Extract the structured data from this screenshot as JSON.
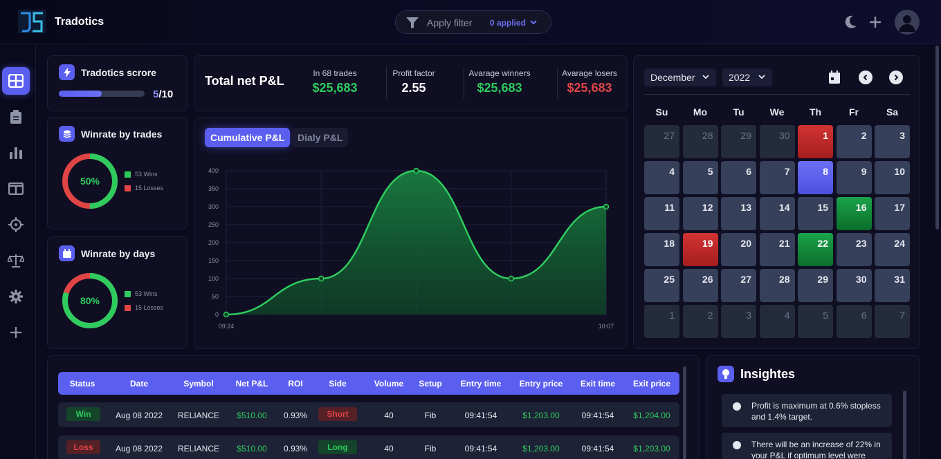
{
  "app": {
    "title": "Tradotics"
  },
  "filter": {
    "label": "Apply filter",
    "applied": "0 applied"
  },
  "sidebar": {
    "items": [
      "dashboard",
      "journal",
      "reports",
      "layout",
      "target",
      "compare",
      "settings",
      "add"
    ]
  },
  "score": {
    "title": "Tradotics scrore",
    "value": "5",
    "max": "/10",
    "fraction": 0.5
  },
  "winrate_trades": {
    "title": "Winrate by trades",
    "percent": "50%",
    "wins": "53 Wins",
    "losses": "15 Losses",
    "win_fraction": 0.5
  },
  "winrate_days": {
    "title": "Winrate by days",
    "percent": "80%",
    "wins": "53 Wins",
    "losses": "15 Losses",
    "win_fraction": 0.8
  },
  "summary": {
    "title": "Total net P&L",
    "stats": [
      {
        "label": "In 68 trades",
        "value": "$25,683",
        "color": "#2fcb5f"
      },
      {
        "label": "Profit factor",
        "value": "2.55",
        "color": "#ffffff"
      },
      {
        "label": "Avarage winners",
        "value": "$25,683",
        "color": "#2fcb5f"
      },
      {
        "label": "Avarage losers",
        "value": "$25,683",
        "color": "#e04545"
      }
    ]
  },
  "chart_tabs": {
    "active": "Cumulative P&L",
    "inactive": "Dialy P&L"
  },
  "chart_data": {
    "type": "area",
    "x": [
      "09:24",
      "",
      "",
      "",
      "10:07"
    ],
    "values": [
      0,
      100,
      400,
      100,
      300
    ],
    "y_ticks": [
      "0",
      "50",
      "100",
      "150",
      "200",
      "250",
      "300",
      "350",
      "400"
    ],
    "x_tick_labels": [
      "09:24",
      "10:07"
    ],
    "ylim": [
      0,
      400
    ],
    "grid": true,
    "color": "#2fcb5f"
  },
  "calendar": {
    "month": "December",
    "year": "2022",
    "weekdays": [
      "Su",
      "Mo",
      "Tu",
      "We",
      "Th",
      "Fr",
      "Sa"
    ],
    "days": [
      {
        "d": "27",
        "s": "muted"
      },
      {
        "d": "28",
        "s": "muted"
      },
      {
        "d": "29",
        "s": "muted"
      },
      {
        "d": "30",
        "s": "muted"
      },
      {
        "d": "1",
        "s": "red"
      },
      {
        "d": "2",
        "s": ""
      },
      {
        "d": "3",
        "s": ""
      },
      {
        "d": "4",
        "s": ""
      },
      {
        "d": "5",
        "s": ""
      },
      {
        "d": "6",
        "s": ""
      },
      {
        "d": "7",
        "s": ""
      },
      {
        "d": "8",
        "s": "blue"
      },
      {
        "d": "9",
        "s": ""
      },
      {
        "d": "10",
        "s": ""
      },
      {
        "d": "11",
        "s": ""
      },
      {
        "d": "12",
        "s": ""
      },
      {
        "d": "13",
        "s": ""
      },
      {
        "d": "14",
        "s": ""
      },
      {
        "d": "15",
        "s": ""
      },
      {
        "d": "16",
        "s": "green"
      },
      {
        "d": "17",
        "s": ""
      },
      {
        "d": "18",
        "s": ""
      },
      {
        "d": "19",
        "s": "red"
      },
      {
        "d": "20",
        "s": ""
      },
      {
        "d": "21",
        "s": ""
      },
      {
        "d": "22",
        "s": "green"
      },
      {
        "d": "23",
        "s": ""
      },
      {
        "d": "24",
        "s": ""
      },
      {
        "d": "25",
        "s": ""
      },
      {
        "d": "26",
        "s": ""
      },
      {
        "d": "27",
        "s": ""
      },
      {
        "d": "28",
        "s": ""
      },
      {
        "d": "29",
        "s": ""
      },
      {
        "d": "30",
        "s": ""
      },
      {
        "d": "31",
        "s": ""
      },
      {
        "d": "1",
        "s": "muted"
      },
      {
        "d": "2",
        "s": "muted"
      },
      {
        "d": "3",
        "s": "muted"
      },
      {
        "d": "4",
        "s": "muted"
      },
      {
        "d": "5",
        "s": "muted"
      },
      {
        "d": "6",
        "s": "muted"
      },
      {
        "d": "7",
        "s": "muted"
      }
    ]
  },
  "table": {
    "headers": [
      "Status",
      "Date",
      "Symbol",
      "Net P&L",
      "ROI",
      "Side",
      "Volume",
      "Setup",
      "Entry time",
      "Entry price",
      "Exit time",
      "Exit price"
    ],
    "rows": [
      {
        "status": "Win",
        "date": "Aug 08 2022",
        "symbol": "RELIANCE",
        "pnl": "$510.00",
        "roi": "0.93%",
        "side": "Short",
        "volume": "40",
        "setup": "Fib",
        "entry_time": "09:41:54",
        "entry_price": "$1,203.00",
        "exit_time": "09:41:54",
        "exit_price": "$1,204.00"
      },
      {
        "status": "Loss",
        "date": "Aug 08 2022",
        "symbol": "RELIANCE",
        "pnl": "$510.00",
        "roi": "0.93%",
        "side": "Long",
        "volume": "40",
        "setup": "Fib",
        "entry_time": "09:41:54",
        "entry_price": "$1,203.00",
        "exit_time": "09:41:54",
        "exit_price": "$1,203.00"
      }
    ]
  },
  "insights": {
    "title": "Insightes",
    "items": [
      "Profit is maximum at 0.6% stopless and 1.4% target.",
      "There will be an increase of 22% in your P&L if optimum level were"
    ]
  },
  "colors": {
    "accent": "#5b5ff0",
    "green": "#2fcb5f",
    "red": "#e04545",
    "background": "#0b0a1f",
    "card": "#0f0e22"
  }
}
